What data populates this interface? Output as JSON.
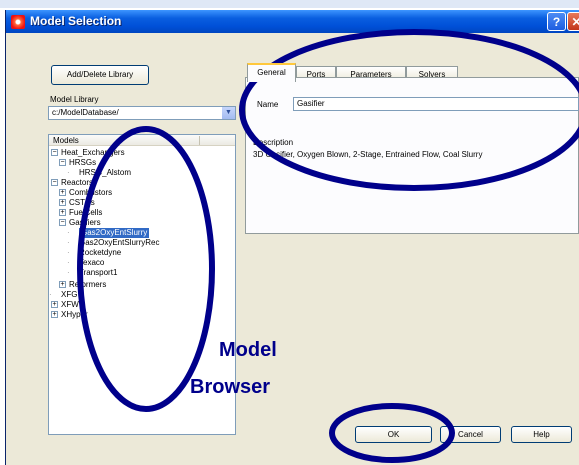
{
  "window": {
    "title": "Model Selection",
    "help_btn": "?",
    "close_btn": "✕"
  },
  "library": {
    "add_delete_button": "Add/Delete Library",
    "model_library_label": "Model Library",
    "path": "c:/ModelDatabase/"
  },
  "tree": {
    "header": "Models",
    "nodes": [
      {
        "label": "Heat_Exchangers",
        "expander": "−"
      },
      {
        "label": "HRSGs",
        "expander": "−"
      },
      {
        "label": "HRSG_Alstom",
        "expander": ""
      },
      {
        "label": "Reactors",
        "expander": "−"
      },
      {
        "label": "Combustors",
        "expander": "+"
      },
      {
        "label": "CSTRs",
        "expander": "+"
      },
      {
        "label": "FuelCells",
        "expander": "+"
      },
      {
        "label": "Gasifiers",
        "expander": "−"
      },
      {
        "label": "Gas2OxyEntSlurry",
        "expander": ""
      },
      {
        "label": "Gas2OxyEntSlurryRec",
        "expander": ""
      },
      {
        "label": "Rocketdyne",
        "expander": ""
      },
      {
        "label": "Texaco",
        "expander": ""
      },
      {
        "label": "Transport1",
        "expander": ""
      },
      {
        "label": "Reformers",
        "expander": "+"
      },
      {
        "label": "XFG",
        "expander": ""
      },
      {
        "label": "XFW",
        "expander": "+"
      },
      {
        "label": "XHyper",
        "expander": "+"
      }
    ]
  },
  "tabs": [
    {
      "label": "General"
    },
    {
      "label": "Ports"
    },
    {
      "label": "Parameters"
    },
    {
      "label": "Solvers"
    }
  ],
  "general": {
    "name_label": "Name",
    "name_value": "Gasifier",
    "description_label": "Description",
    "description_value": "3D Gasifier, Oxygen Blown, 2-Stage, Entrained Flow, Coal Slurry"
  },
  "buttons": {
    "ok": "OK",
    "cancel": "Cancel",
    "help": "Help"
  },
  "annotation": {
    "line1": "Model",
    "line2": "Browser",
    "ellipse_color": "#00008b"
  }
}
